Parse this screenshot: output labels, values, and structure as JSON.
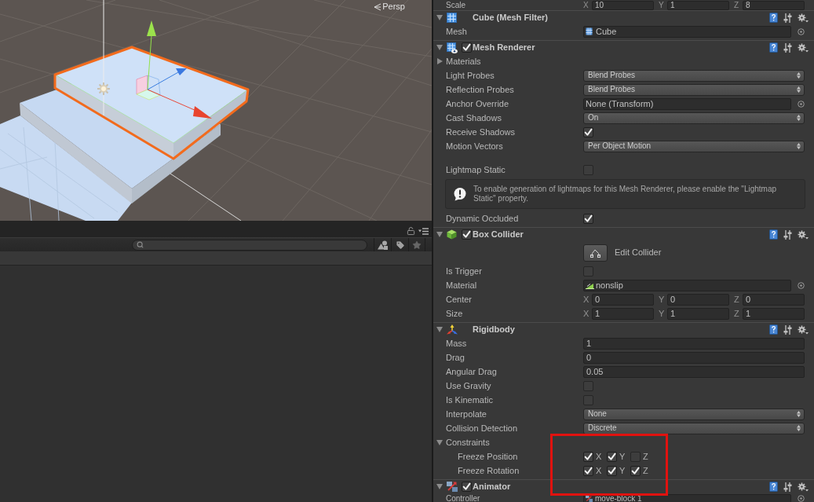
{
  "scene_view": {
    "camera_label": "Persp"
  },
  "inspector": {
    "top_rows": [
      {
        "kind": "vector",
        "label": "Scale",
        "axes": [
          {
            "axis": "X",
            "value": "10"
          },
          {
            "axis": "Y",
            "value": "1"
          },
          {
            "axis": "Z",
            "value": "8"
          }
        ]
      }
    ],
    "components": [
      {
        "kind": "meshfilter",
        "title": "Cube (Mesh Filter)",
        "expanded": true,
        "rows": [
          {
            "kind": "object",
            "label": "Mesh",
            "value": "Cube",
            "asset": {
              "kind": "mesh"
            }
          }
        ]
      },
      {
        "kind": "meshrenderer",
        "title": "Mesh Renderer",
        "enabled": true,
        "expanded": true,
        "rows": [
          {
            "kind": "foldout",
            "label": "Materials",
            "expanded": false
          },
          {
            "kind": "dropdown",
            "label": "Light Probes",
            "value": "Blend Probes"
          },
          {
            "kind": "dropdown",
            "label": "Reflection Probes",
            "value": "Blend Probes"
          },
          {
            "kind": "object",
            "label": "Anchor Override",
            "value": "None (Transform)"
          },
          {
            "kind": "dropdown",
            "label": "Cast Shadows",
            "value": "On"
          },
          {
            "kind": "checkbox",
            "label": "Receive Shadows",
            "checked": true
          },
          {
            "kind": "dropdown",
            "label": "Motion Vectors",
            "value": "Per Object Motion"
          },
          {
            "kind": "space"
          },
          {
            "kind": "checkbox",
            "label": "Lightmap Static",
            "checked": false
          },
          {
            "kind": "help",
            "text": "To enable generation of lightmaps for this Mesh Renderer, please enable the \"Lightmap Static\" property."
          },
          {
            "kind": "checkbox",
            "label": "Dynamic Occluded",
            "checked": true
          }
        ]
      },
      {
        "kind": "boxcollider",
        "title": "Box Collider",
        "enabled": true,
        "expanded": true,
        "rows": [
          {
            "kind": "button",
            "label": "Edit Collider"
          },
          {
            "kind": "checkbox",
            "label": "Is Trigger",
            "checked": false
          },
          {
            "kind": "object",
            "label": "Material",
            "value": "nonslip",
            "asset": {
              "kind": "physicmaterial"
            }
          },
          {
            "kind": "vector",
            "label": "Center",
            "axes": [
              {
                "axis": "X",
                "value": "0"
              },
              {
                "axis": "Y",
                "value": "0"
              },
              {
                "axis": "Z",
                "value": "0"
              }
            ]
          },
          {
            "kind": "vector",
            "label": "Size",
            "axes": [
              {
                "axis": "X",
                "value": "1"
              },
              {
                "axis": "Y",
                "value": "1"
              },
              {
                "axis": "Z",
                "value": "1"
              }
            ]
          }
        ]
      },
      {
        "kind": "rigidbody",
        "title": "Rigidbody",
        "expanded": true,
        "rows": [
          {
            "kind": "text",
            "label": "Mass",
            "value": "1"
          },
          {
            "kind": "text",
            "label": "Drag",
            "value": "0"
          },
          {
            "kind": "text",
            "label": "Angular Drag",
            "value": "0.05"
          },
          {
            "kind": "checkbox",
            "label": "Use Gravity",
            "checked": false
          },
          {
            "kind": "checkbox",
            "label": "Is Kinematic",
            "checked": false
          },
          {
            "kind": "dropdown",
            "label": "Interpolate",
            "value": "None"
          },
          {
            "kind": "dropdown",
            "label": "Collision Detection",
            "value": "Discrete"
          },
          {
            "kind": "foldout",
            "label": "Constraints",
            "expanded": true,
            "children": [
              {
                "kind": "toggles",
                "label": "Freeze Position",
                "toggles": [
                  {
                    "axis": "X",
                    "checked": true
                  },
                  {
                    "axis": "Y",
                    "checked": true
                  },
                  {
                    "axis": "Z",
                    "checked": false
                  }
                ]
              },
              {
                "kind": "toggles",
                "label": "Freeze Rotation",
                "toggles": [
                  {
                    "axis": "X",
                    "checked": true
                  },
                  {
                    "axis": "Y",
                    "checked": true
                  },
                  {
                    "axis": "Z",
                    "checked": true
                  }
                ]
              }
            ]
          }
        ]
      },
      {
        "kind": "animator",
        "title": "Animator",
        "enabled": true,
        "expanded": true,
        "rows": [
          {
            "kind": "object",
            "label": "Controller",
            "value": "move-block 1",
            "asset": {
              "kind": "controller"
            }
          }
        ]
      }
    ]
  }
}
